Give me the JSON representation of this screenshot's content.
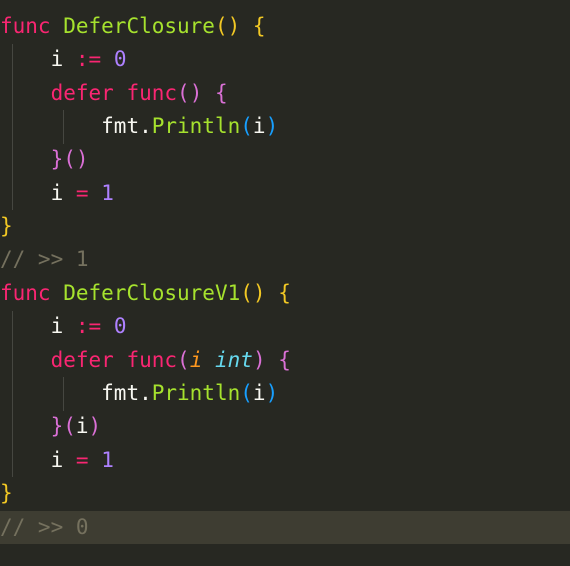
{
  "editor": {
    "theme_colors": {
      "background": "#272822",
      "current_line": "#3e3d32",
      "keyword": "#f92672",
      "function_name": "#a6e22e",
      "number": "#ae81ff",
      "comment": "#75715e",
      "type": "#66d9ef",
      "parameter": "#fd971f",
      "bracket_level_1": "#f2c824",
      "bracket_level_2": "#da70d6",
      "bracket_level_3": "#179fff"
    },
    "lines": [
      [
        "func",
        " ",
        "DeferClosure",
        "(",
        ")",
        " ",
        "{"
      ],
      [
        "    ",
        "i",
        " ",
        ":=",
        " ",
        "0"
      ],
      [
        "    ",
        "defer",
        " ",
        "func",
        "(",
        ")",
        " ",
        "{"
      ],
      [
        "        ",
        "fmt.",
        "Println",
        "(",
        "i",
        ")"
      ],
      [
        "    ",
        "}",
        "(",
        ")"
      ],
      [
        "    ",
        "i",
        " ",
        "=",
        " ",
        "1"
      ],
      [
        "}"
      ],
      [
        "// >> 1"
      ],
      [
        "func",
        " ",
        "DeferClosureV1",
        "(",
        ")",
        " ",
        "{"
      ],
      [
        "    ",
        "i",
        " ",
        ":=",
        " ",
        "0"
      ],
      [
        "    ",
        "defer",
        " ",
        "func",
        "(",
        "i",
        " ",
        "int",
        ")",
        " ",
        "{"
      ],
      [
        "        ",
        "fmt.",
        "Println",
        "(",
        "i",
        ")"
      ],
      [
        "    ",
        "}",
        "(",
        "i",
        ")"
      ],
      [
        "    ",
        "i",
        " ",
        "=",
        " ",
        "1"
      ],
      [
        "}"
      ],
      [
        "// >> 0"
      ]
    ]
  }
}
